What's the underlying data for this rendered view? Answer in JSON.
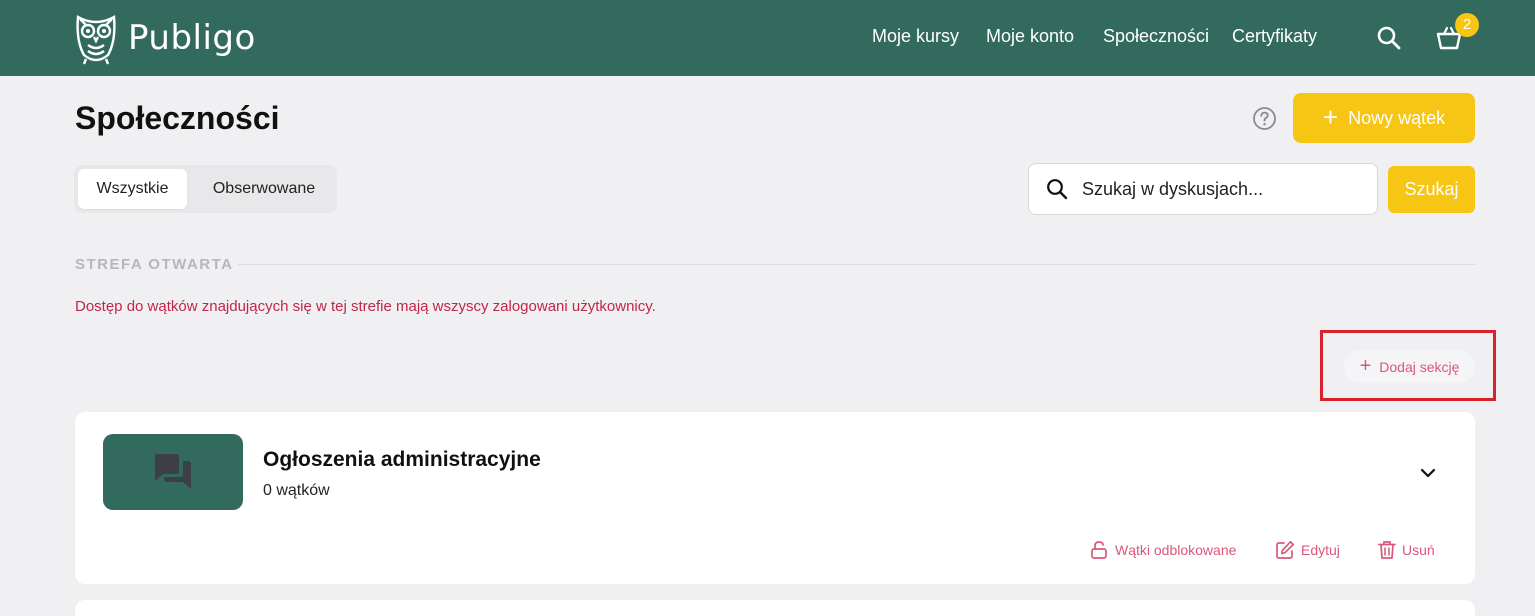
{
  "header": {
    "brand": "Publigo",
    "nav": [
      "Moje kursy",
      "Moje konto",
      "Społeczności",
      "Certyfikaty"
    ],
    "cart_count": "2",
    "icons": [
      "owl-logo-icon",
      "search-icon",
      "cart-icon"
    ]
  },
  "page": {
    "title": "Społeczności",
    "new_thread_label": "Nowy wątek",
    "tabs": [
      "Wszystkie",
      "Obserwowane"
    ],
    "active_tab": "Wszystkie",
    "search": {
      "placeholder": "Szukaj w dyskusjach...",
      "button_label": "Szukaj"
    }
  },
  "zone": {
    "title": "STREFA OTWARTA",
    "description": "Dostęp do wątków znajdujących się w tej strefie mają wszyscy zalogowani użytkownicy.",
    "add_section_label": "Dodaj sekcję"
  },
  "sections": [
    {
      "title": "Ogłoszenia administracyjne",
      "count": "0 wątków",
      "actions": [
        "Wątki odblokowane",
        "Edytuj",
        "Usuń"
      ]
    }
  ],
  "colors": {
    "header_bg": "#336a5e",
    "accent_yellow": "#f7c514",
    "link_pink": "#d9577a",
    "description_red": "#c0264a",
    "highlight_red": "#d8222b"
  }
}
